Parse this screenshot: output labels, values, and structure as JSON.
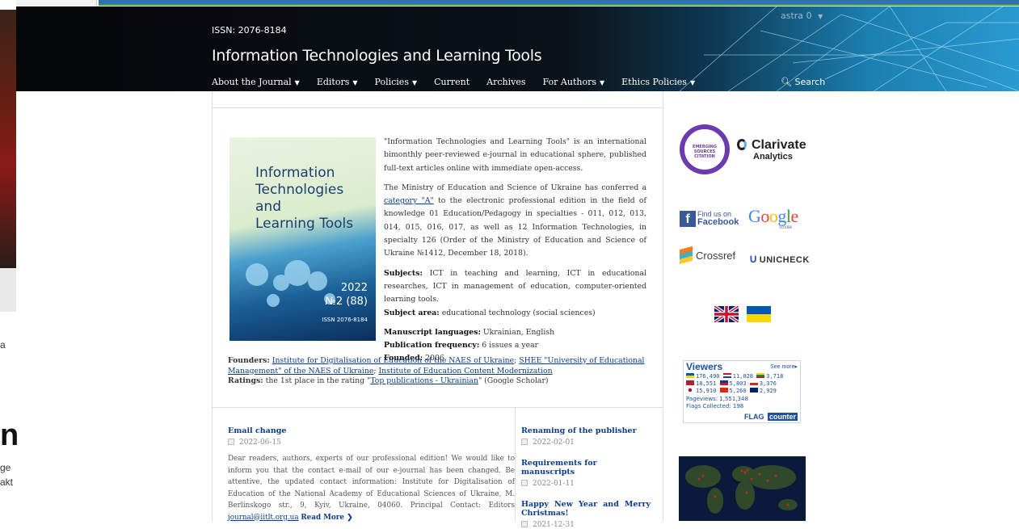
{
  "left_strip": {
    "big_letter": "n",
    "text1": "ge",
    "text2": "akt",
    "text3": "a"
  },
  "header": {
    "issn": "ISSN: 2076-8184",
    "title": "Information Technologies and Learning Tools",
    "user": "astra",
    "nav": [
      {
        "label": "About the Journal",
        "dropdown": true
      },
      {
        "label": "Editors",
        "dropdown": true
      },
      {
        "label": "Policies",
        "dropdown": true
      },
      {
        "label": "Current",
        "dropdown": false
      },
      {
        "label": "Archives",
        "dropdown": false
      },
      {
        "label": "For Authors",
        "dropdown": true
      },
      {
        "label": "Ethics Policies",
        "dropdown": true
      }
    ],
    "search_label": "Search"
  },
  "cover": {
    "title_lines": [
      "Information",
      "Technologies",
      "and",
      "Learning Tools"
    ],
    "year": "2022",
    "issue": "№2 (88)",
    "issn": "ISSN 2076-8184"
  },
  "about": {
    "p1": "\"Information Technologies and Learning Tools\" is an international bimonthly peer-reviewed e-journal in educational sphere, published full-text articles online with immediate open-access.",
    "p2_pre": "The Ministry of Education and Science of Ukraine has conferred a ",
    "p2_link": "category \"A\"",
    "p2_post": " to the electronic professional edition in the field of knowledge 01 Education/Pedagogy in specialties - 011, 012, 013, 014, 015, 016, 017, as well as 12 Information Technologies, in specialty 126 (Order of the Ministry of Education and Science of Ukraine №1412, December 18, 2018).",
    "subjects_label": "Subjects:",
    "subjects": " ICT in teaching and learning, ICT in educational researches, ICT in management of education, computer-oriented learning tools.",
    "area_label": "Subject area:",
    "area": " educational technology (social sciences)",
    "lang_label": "Manuscript languages:",
    "lang": " Ukrainian, English",
    "freq_label": "Publication frequency:",
    "freq": " 6 issues a year",
    "founded_label": "Founded:",
    "founded": " 2006",
    "founders_label": "Founders:",
    "founder1": "Institute for Digitalisation of Education of the NAES of Ukraine",
    "founder2": "SHEE \"University of Educational Management\" of the NAES of Ukraine",
    "founder3": "Institute of Education Content Modernization",
    "ratings_label": "Ratings:",
    "ratings_pre": " the 1st place in the rating \"",
    "ratings_link": "Top publications - Ukrainian",
    "ratings_post": "\" (Google Scholar)"
  },
  "news_main": {
    "title": "Email change",
    "date": "2022-06-15",
    "body": "Dear readers, authors, experts of our professional edition! We would like to inform you that the contact e-mail of our e-journal has been changed. Be attentive, the updated contact information: Institute for Digitalisation of Education of the National Academy of Educational Sciences of Ukraine, M. Berlinskogo str., 9, Kyiv, Ukraine, 04060. Principal Contact: Editors ",
    "email": "journal@iitlt.org.ua",
    "read_more": "Read More"
  },
  "news_side": [
    {
      "title": "Renaming of the publisher",
      "date": "2022-02-01"
    },
    {
      "title": "Requirements for manuscripts",
      "date": "2022-01-11"
    },
    {
      "title": "Happy New Year and Merry Christmas!",
      "date": "2021-12-31"
    }
  ],
  "sidebar": {
    "esci": "EMERGING SOURCES CITATION",
    "clarivate": "Clarivate",
    "clarivate_sub": "Analytics",
    "fb_find": "Find us on",
    "fb_name": "Facebook",
    "google": "Google",
    "google_sub": "scholar",
    "crossref": "Crossref",
    "unicheck": "UNICHECK",
    "viewers": {
      "title": "Viewers",
      "more": "See more",
      "rows": [
        [
          "176,490",
          "11,028",
          "3,718"
        ],
        [
          "18,551",
          "5,803",
          "3,376"
        ],
        [
          "15,910",
          "5,260",
          "2,929"
        ]
      ],
      "pageviews": "Pageviews: 1,551,348",
      "flags": "Flags Collected: 198",
      "brand1": "FLAG",
      "brand2": "counter"
    }
  },
  "colors": {
    "link": "#0b3c8c",
    "header_dark": "#05070a",
    "header_blue": "#2a9ad0"
  }
}
